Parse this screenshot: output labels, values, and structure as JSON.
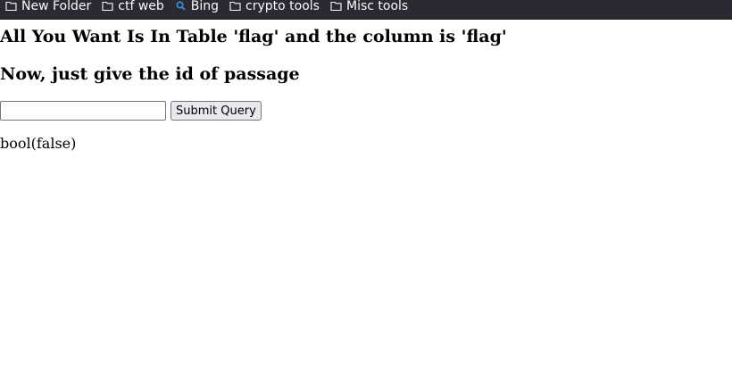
{
  "bookmarks": [
    {
      "label": "New Folder",
      "icon": "folder-icon"
    },
    {
      "label": "ctf web",
      "icon": "folder-icon"
    },
    {
      "label": "Bing",
      "icon": "search-icon"
    },
    {
      "label": "crypto tools",
      "icon": "folder-icon"
    },
    {
      "label": "Misc tools",
      "icon": "folder-icon"
    }
  ],
  "page": {
    "heading1": "All You Want Is In Table 'flag' and the column is 'flag'",
    "heading2": "Now, just give the id of passage",
    "input_value": "",
    "submit_label": "Submit Query",
    "result": "bool(false)"
  },
  "colors": {
    "toolbar_bg": "#2b2a33",
    "toolbar_text": "#fbfbfe",
    "bing_icon": "#3b8fd9"
  }
}
